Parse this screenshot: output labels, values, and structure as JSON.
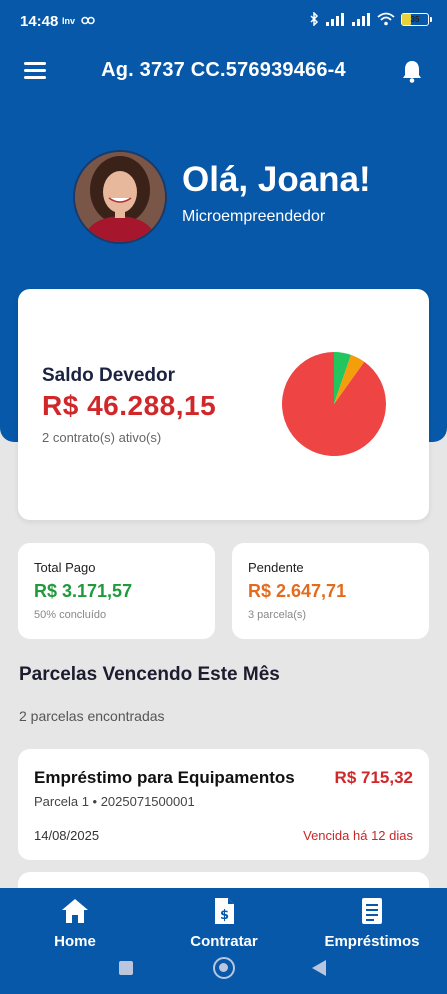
{
  "status_bar": {
    "time": "14:48",
    "carrier_icons": "Inv",
    "battery": "35"
  },
  "header": {
    "title": "Ag. 3737 CC.576939466-4",
    "menu_icon": "menu-icon",
    "bell_icon": "bell-icon"
  },
  "profile": {
    "greeting": "Olá, Joana!",
    "role": "Microempreendedor"
  },
  "balance": {
    "label": "Saldo Devedor",
    "value": "R$ 46.288,15",
    "contracts": "2 contrato(s) ativo(s)"
  },
  "chart_data": {
    "type": "pie",
    "slices": [
      {
        "value": 90.1,
        "color": "#ef4444"
      },
      {
        "value": 5.3,
        "color": "#22c55e"
      },
      {
        "value": 4.6,
        "color": "#f59e0b"
      }
    ]
  },
  "stats": {
    "paid": {
      "label": "Total Pago",
      "value": "R$ 3.171,57",
      "sub": "50% concluído"
    },
    "pending": {
      "label": "Pendente",
      "value": "R$ 2.647,71",
      "sub": "3 parcela(s)"
    }
  },
  "section": {
    "title": "Parcelas Vencendo Este Mês",
    "count": "2 parcelas encontradas"
  },
  "loans": [
    {
      "title": "Empréstimo para Equipamentos",
      "amount": "R$ 715,32",
      "installment": "Parcela 1 • 2025071500001",
      "date": "14/08/2025",
      "status": "Vencida há 12 dias"
    }
  ],
  "nav": {
    "home": "Home",
    "contratar": "Contratar",
    "emprestimos": "Empréstimos"
  },
  "colors": {
    "primary": "#0758a8",
    "danger": "#d0282a",
    "success": "#1f9a3c",
    "warning": "#e46b1e"
  }
}
